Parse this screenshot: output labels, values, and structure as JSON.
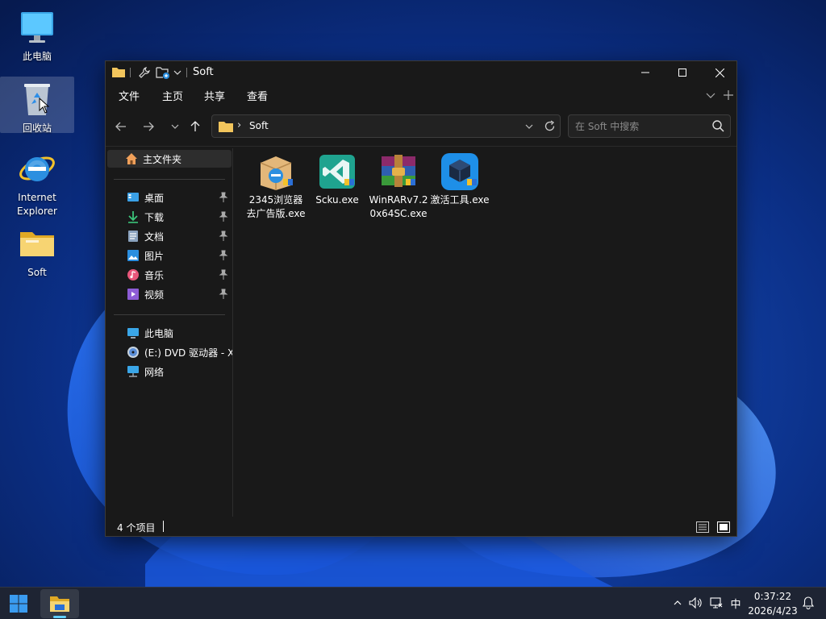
{
  "desktop": {
    "icons": [
      {
        "label": "此电脑"
      },
      {
        "label": "回收站"
      },
      {
        "label": "Internet Explorer"
      },
      {
        "label": "Soft"
      }
    ]
  },
  "window": {
    "title": "Soft",
    "menu": [
      "文件",
      "主页",
      "共享",
      "查看"
    ],
    "address": {
      "path": [
        "Soft"
      ]
    },
    "search": {
      "placeholder": "在 Soft 中搜索"
    },
    "sidebar": {
      "home": "主文件夹",
      "quick_access": [
        {
          "label": "桌面",
          "icon": "desktop-icon"
        },
        {
          "label": "下载",
          "icon": "download-icon"
        },
        {
          "label": "文档",
          "icon": "document-icon"
        },
        {
          "label": "图片",
          "icon": "picture-icon"
        },
        {
          "label": "音乐",
          "icon": "music-icon"
        },
        {
          "label": "视频",
          "icon": "video-icon"
        }
      ],
      "devices": [
        {
          "label": "此电脑",
          "icon": "computer-icon"
        },
        {
          "label": "(E:) DVD 驱动器 - X",
          "icon": "dvd-icon"
        },
        {
          "label": "网络",
          "icon": "network-icon"
        }
      ]
    },
    "files": [
      {
        "name": "2345浏览器去广告版.exe",
        "icon": "browser-installer-icon"
      },
      {
        "name": "Scku.exe",
        "icon": "visual-studio-icon"
      },
      {
        "name": "WinRARv7.20x64SC.exe",
        "icon": "winrar-icon"
      },
      {
        "name": "激活工具.exe",
        "icon": "activation-tool-icon"
      }
    ],
    "status": "4 个项目"
  },
  "taskbar": {
    "ime": "中",
    "time": "0:37:22",
    "date": "2026/4/23"
  },
  "colors": {
    "window_bg": "#191919",
    "accent": "#60cdff",
    "folder": "#f2c55c"
  }
}
